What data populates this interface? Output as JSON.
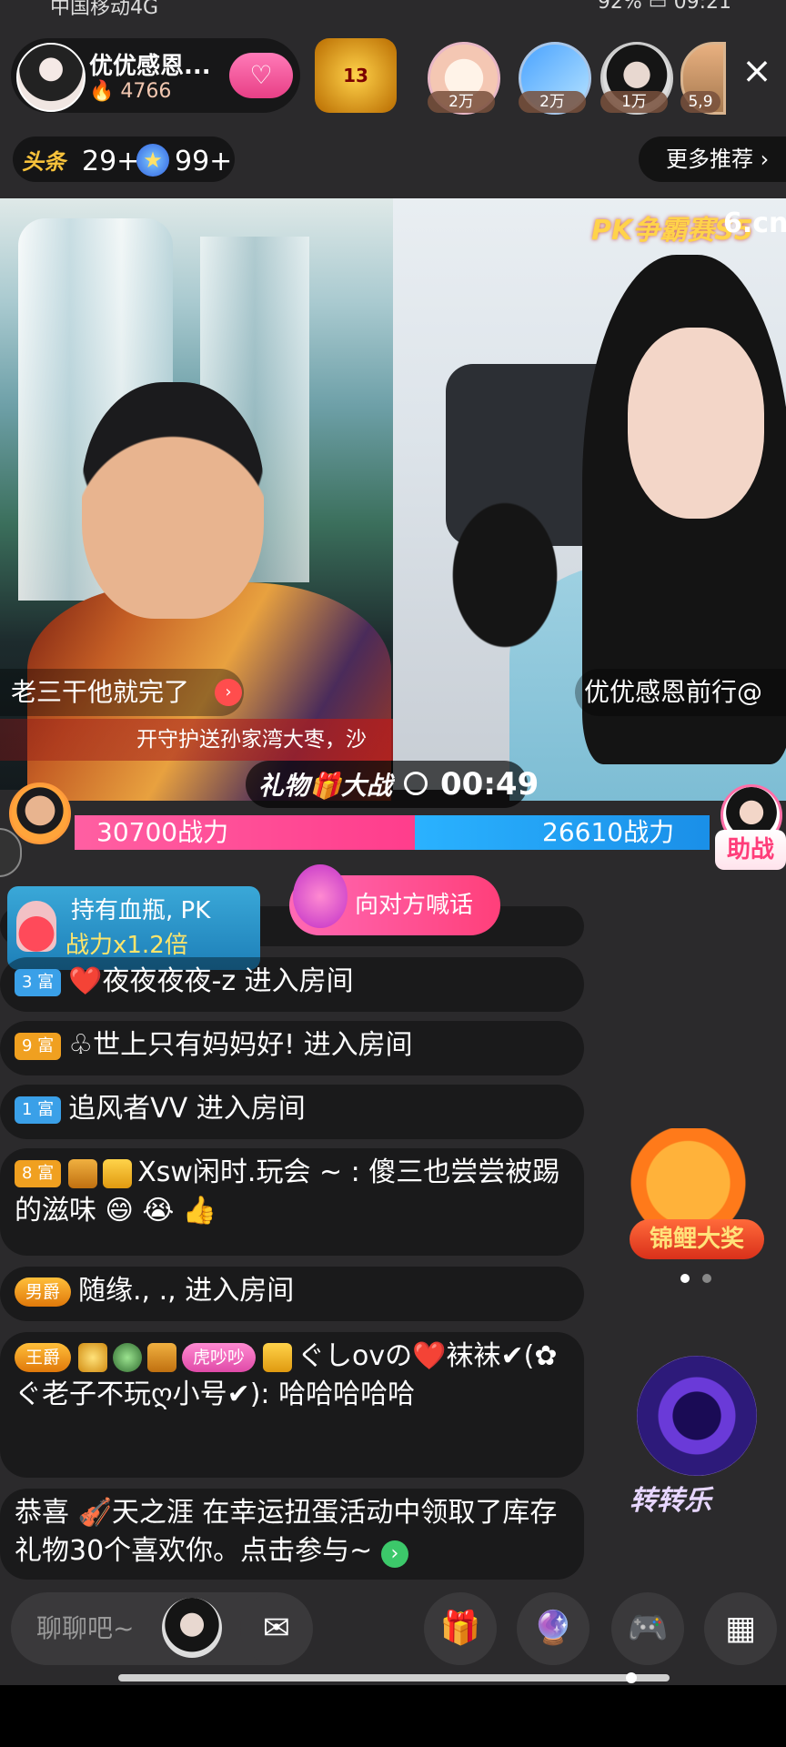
{
  "status_bar": {
    "carrier": "中国移动4G",
    "battery": "92%",
    "time": "09:21"
  },
  "host": {
    "name": "优优感恩...",
    "fans": "4766"
  },
  "viewers": [
    {
      "tag": "2万"
    },
    {
      "tag": "2万"
    },
    {
      "tag": "1万"
    },
    {
      "tag": "5,9"
    }
  ],
  "rank": {
    "label": "13"
  },
  "badges": {
    "toutiao": "头条",
    "count_a": "29+",
    "count_b": "99+"
  },
  "more_recommend": "更多推荐",
  "stream": {
    "pk_logo": "PK争霸赛S5",
    "pk_logo_brand": "6.cn",
    "left_name": "老三干他就完了",
    "right_name": "优优感恩前行@",
    "marquee": "开守护送孙家湾大枣，沙"
  },
  "pk": {
    "title": "礼物🎁大战",
    "time": "00:49",
    "left_power": "30700战力",
    "right_power": "26610战力",
    "left_value": 30700,
    "right_value": 26610,
    "help": "助战"
  },
  "potion": {
    "line1": "持有血瓶, PK",
    "line2": "战力x1.2倍"
  },
  "shout": "向对方喊话",
  "chat": [
    {
      "level": "3 富",
      "level_color": "blue",
      "prefix": "❤️",
      "text": "夜夜夜夜-z 进入房间"
    },
    {
      "level": "9 富",
      "level_color": "gold",
      "prefix": "♧",
      "text": "世上只有妈妈好! 进入房间"
    },
    {
      "level": "1 富",
      "level_color": "blue",
      "prefix": "",
      "text": "追风者VV 进入房间"
    },
    {
      "level": "8 富",
      "level_color": "gold",
      "prefix": "",
      "text": "Xsw闲时.玩会 ~ : 傻三也尝尝被踢的滋味 😄 😭 👍"
    },
    {
      "noble": "男爵",
      "text": "随缘.,  .,    进入房间"
    },
    {
      "noble": "王爵",
      "pet_tag": "虎吵吵",
      "text": "ぐしovの❤️袜袜✔(✿ぐ老子不玩ღ小号✔): 哈哈哈哈哈"
    },
    {
      "text": "恭喜 🎻天之涯  在幸运扭蛋活动中领取了库存礼物30个喜欢你。点击参与~"
    }
  ],
  "promos": {
    "koi": "锦鲤大奖",
    "wheel": "转转乐"
  },
  "bottom": {
    "chat_placeholder": "聊聊吧~"
  },
  "colors": {
    "pink": "#ff3d8c",
    "blue": "#1a8fe8",
    "gold": "#f0a020"
  }
}
